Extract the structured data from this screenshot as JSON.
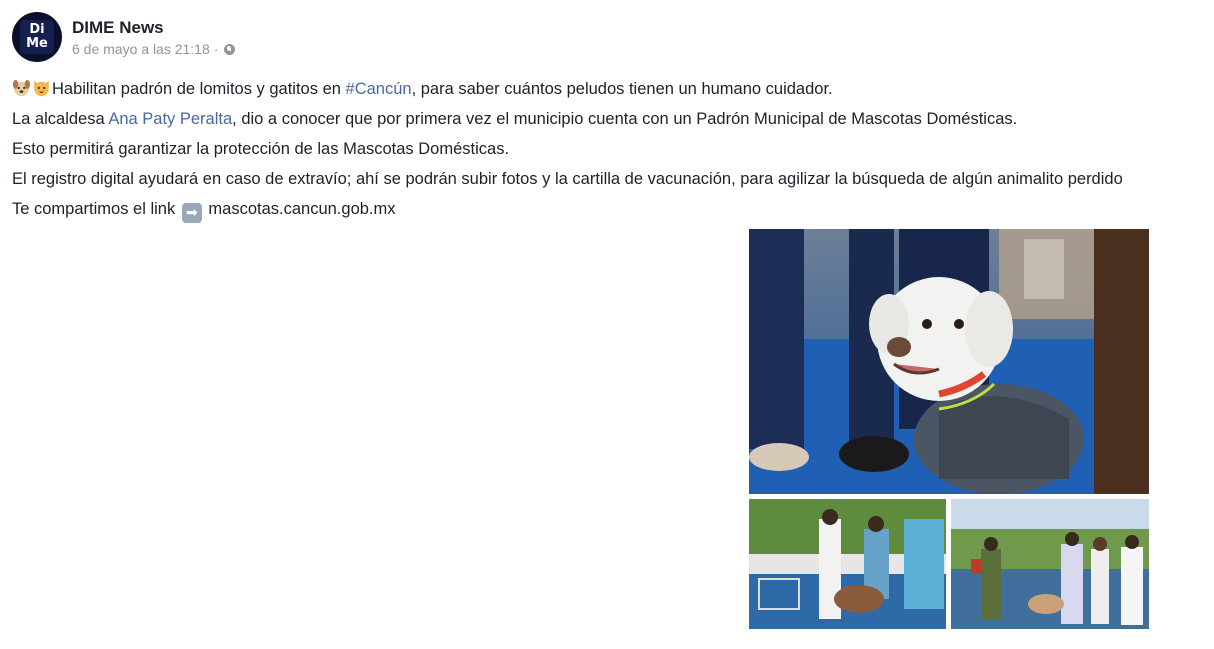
{
  "post": {
    "author": "DIME News",
    "avatar_text_top": "Di",
    "avatar_text_bottom": "Me",
    "timestamp": "6 de mayo a las 21:18",
    "separator": "·",
    "privacy_icon": "globe-icon",
    "lines": {
      "line1_emojis": [
        "dog-face-emoji",
        "cat-face-emoji"
      ],
      "line1_pre": "Habilitan padrón de lomitos y gatitos en ",
      "line1_hashtag": "#Cancún",
      "line1_post": ", para saber cuántos peludos tienen un humano cuidador.",
      "line2_pre": "La alcaldesa ",
      "line2_mention": "Ana Paty Peralta",
      "line2_post": ", dio a conocer que por primera vez el municipio cuenta con un Padrón Municipal de Mascotas Domésticas.",
      "line3": "Esto permitirá garantizar la protección de las Mascotas Domésticas.",
      "line4": "El registro digital ayudará en caso de extravío; ahí se podrán subir fotos y la cartilla de vacunación, para agilizar la búsqueda de algún animalito perdido",
      "line5_pre": "Te compartimos el link ",
      "line5_emoji": "right-arrow-emoji",
      "line5_link": "mascotas.cancun.gob.mx"
    }
  },
  "colors": {
    "text": "#1d2129",
    "meta": "#90949c",
    "link": "#4b67a1",
    "avatar_bg": "#0b0f2e"
  },
  "photos": [
    {
      "name": "white-dog-with-shirt-photo"
    },
    {
      "name": "people-with-dogs-park-photo"
    },
    {
      "name": "group-with-pets-photo"
    }
  ]
}
